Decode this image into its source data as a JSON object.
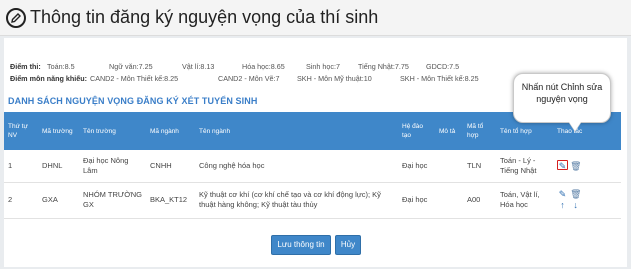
{
  "header": {
    "title": "Thông tin đăng ký nguyện vọng của thí sinh"
  },
  "scores": {
    "label": "Điểm thi:",
    "items": [
      "Toán:8.5",
      "Ngữ văn:7.25",
      "Vật lí:8.13",
      "Hóa học:8.65",
      "Sinh học:7",
      "Tiếng Nhật:7.75",
      "GDCD:7.5"
    ]
  },
  "talent_scores": {
    "label": "Điểm môn năng khiếu:",
    "items": [
      "CAND2 - Môn Thiết kế:8.25",
      "CAND2 - Môn Vẽ:7",
      "SKH - Môn Mỹ thuật:10",
      "SKH - Môn Thiết kế:8.25"
    ]
  },
  "section_title": "DANH SÁCH NGUYỆN VỌNG ĐĂNG KÝ XÉT TUYỂN SINH",
  "table": {
    "headers": [
      "Thứ tự NV",
      "Mã trường",
      "Tên trường",
      "Mã ngành",
      "Tên ngành",
      "Hệ đào tạo",
      "Mô tả",
      "Mã tổ hợp",
      "Tên tổ hợp",
      "Thao tác"
    ],
    "rows": [
      {
        "order": "1",
        "school_code": "DHNL",
        "school_name": "Đại học Nông Lâm",
        "major_code": "CNHH",
        "major_name": "Công nghệ hóa học",
        "level": "Đại học",
        "desc": "",
        "combo_code": "TLN",
        "combo_name": "Toán - Lý - Tiếng Nhật"
      },
      {
        "order": "2",
        "school_code": "GXA",
        "school_name": "NHÓM TRƯỜNG GX",
        "major_code": "BKA_KT12",
        "major_name": "Kỹ thuật cơ khí (cơ khí chế tạo và cơ khí động lực); Kỹ thuật hàng không; Kỹ thuật tàu thủy",
        "level": "Đại học",
        "desc": "",
        "combo_code": "A00",
        "combo_name": "Toán, Vật lí, Hóa học"
      }
    ]
  },
  "tooltip": "Nhấn nút Chỉnh sửa nguyện vọng",
  "buttons": {
    "save": "Lưu thông tin",
    "cancel": "Hủy"
  },
  "icons": {
    "header": "edit-circle-icon",
    "edit": "edit-icon",
    "delete": "trash-icon",
    "up": "arrow-up-icon",
    "down": "arrow-down-icon"
  },
  "colors": {
    "accent": "#3f87c9",
    "highlight": "#d62020"
  }
}
